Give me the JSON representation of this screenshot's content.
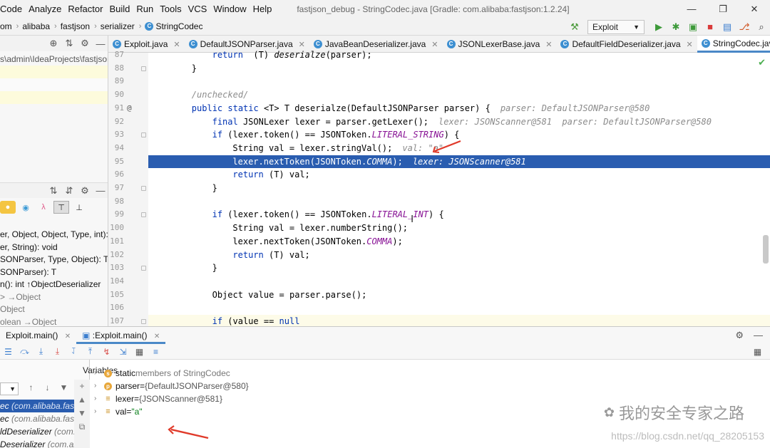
{
  "menu": {
    "items": [
      "Code",
      "Analyze",
      "Refactor",
      "Build",
      "Run",
      "Tools",
      "VCS",
      "Window",
      "Help"
    ],
    "window_title": "fastjson_debug - StringCodec.java [Gradle: com.alibaba:fastjson:1.2.24]",
    "controls": {
      "minimize": "—",
      "restore": "❐",
      "close": "✕"
    }
  },
  "breadcrumb": {
    "items": [
      "om",
      "alibaba",
      "fastjson",
      "serializer",
      "StringCodec"
    ]
  },
  "runbar": {
    "config_label": "Exploit",
    "icons": [
      "hammer-icon",
      "run-icon",
      "debug-icon",
      "coverage-icon",
      "stop-icon",
      "project-structure-icon",
      "git-icon",
      "search-icon"
    ]
  },
  "project_panel": {
    "path_text": "s\\admin\\IdeaProjects\\fastjson"
  },
  "structure_panel": {
    "items": [
      "er, Object, Object, Type, int): v",
      "er, String): void",
      "SONParser, Type, Object): T ↑C",
      "SONParser): T",
      "n(): int ↑ObjectDeserializer",
      "> →Object",
      "Object",
      "olean →Object"
    ]
  },
  "editor": {
    "tabs": [
      {
        "label": "Exploit.java",
        "active": false
      },
      {
        "label": "DefaultJSONParser.java",
        "active": false
      },
      {
        "label": "JavaBeanDeserializer.java",
        "active": false
      },
      {
        "label": "JSONLexerBase.java",
        "active": false
      },
      {
        "label": "DefaultFieldDeserializer.java",
        "active": false
      },
      {
        "label": "StringCodec.java",
        "active": true
      }
    ],
    "lines": [
      {
        "n": "87",
        "indent": 8,
        "parts": [
          [
            "kw",
            "return"
          ],
          [
            "",
            "  (T) "
          ],
          [
            "method",
            "deserialze"
          ],
          [
            "",
            "(parser);"
          ]
        ]
      },
      {
        "n": "88",
        "indent": 4,
        "parts": [
          [
            "",
            "}"
          ]
        ]
      },
      {
        "n": "89",
        "indent": 0,
        "parts": []
      },
      {
        "n": "90",
        "indent": 4,
        "parts": [
          [
            "cmt",
            "/unchecked/"
          ]
        ]
      },
      {
        "n": "91",
        "indent": 4,
        "parts": [
          [
            "kw",
            "public static"
          ],
          [
            "",
            " <T> T deserialze(DefaultJSONParser parser) {"
          ]
        ],
        "inlay": "parser: DefaultJSONParser@580",
        "gutmark": "@"
      },
      {
        "n": "92",
        "indent": 8,
        "parts": [
          [
            "kw",
            "final"
          ],
          [
            "",
            " JSONLexer lexer = parser.getLexer();"
          ]
        ],
        "inlay": "lexer: JSONScanner@581  parser: DefaultJSONParser@580"
      },
      {
        "n": "93",
        "indent": 8,
        "parts": [
          [
            "kw",
            "if"
          ],
          [
            "",
            " (lexer.token() == JSONToken."
          ],
          [
            "fld",
            "LITERAL_STRING"
          ],
          [
            "",
            ") {"
          ]
        ]
      },
      {
        "n": "94",
        "indent": 12,
        "parts": [
          [
            "",
            "String val = lexer.stringVal();"
          ]
        ],
        "inlay": "val: \"a\""
      },
      {
        "n": "95",
        "indent": 12,
        "parts": [
          [
            "",
            "lexer.nextToken(JSONToken."
          ],
          [
            "fld",
            "COMMA"
          ],
          [
            "",
            ");"
          ]
        ],
        "inlay": "lexer: JSONScanner@581",
        "highlight": true
      },
      {
        "n": "96",
        "indent": 12,
        "parts": [
          [
            "kw",
            "return"
          ],
          [
            "",
            " (T) val;"
          ]
        ]
      },
      {
        "n": "97",
        "indent": 8,
        "parts": [
          [
            "",
            "}"
          ]
        ]
      },
      {
        "n": "98",
        "indent": 0,
        "parts": []
      },
      {
        "n": "99",
        "indent": 8,
        "parts": [
          [
            "kw",
            "if"
          ],
          [
            "",
            " (lexer.token() == JSONToken."
          ],
          [
            "fld",
            "LITERAL_INT"
          ],
          [
            "",
            ") {"
          ]
        ]
      },
      {
        "n": "100",
        "indent": 12,
        "parts": [
          [
            "",
            "String val = lexer.numberString();"
          ]
        ]
      },
      {
        "n": "101",
        "indent": 12,
        "parts": [
          [
            "",
            "lexer.nextToken(JSONToken."
          ],
          [
            "fld",
            "COMMA"
          ],
          [
            "",
            ");"
          ]
        ]
      },
      {
        "n": "102",
        "indent": 12,
        "parts": [
          [
            "kw",
            "return"
          ],
          [
            "",
            " (T) val;"
          ]
        ]
      },
      {
        "n": "103",
        "indent": 8,
        "parts": [
          [
            "",
            "}"
          ]
        ]
      },
      {
        "n": "104",
        "indent": 0,
        "parts": []
      },
      {
        "n": "105",
        "indent": 8,
        "parts": [
          [
            "",
            "Object value = parser.parse();"
          ]
        ]
      },
      {
        "n": "106",
        "indent": 0,
        "parts": []
      },
      {
        "n": "107",
        "indent": 8,
        "parts": [
          [
            "kw",
            "if"
          ],
          [
            "",
            " (value == "
          ],
          [
            "kw",
            "null"
          ],
          [
            ") {"
          ]
        ],
        "cursorline": true
      }
    ]
  },
  "debug": {
    "tabs": [
      {
        "label": "Exploit.main()",
        "active": false,
        "close": "✕"
      },
      {
        "label": ":Exploit.main()",
        "active": true,
        "close": "✕"
      }
    ],
    "variables_header": "Variables",
    "frames": [
      {
        "method": "ec",
        "pkg": "(com.alibaba.fastjs",
        "selected": true
      },
      {
        "method": "ec",
        "pkg": "(com.alibaba.fastjs",
        "selected": false
      },
      {
        "method": "ldDeserializer",
        "pkg": "(com.ali",
        "selected": false
      },
      {
        "method": "Deserializer",
        "pkg": "(com.ali",
        "selected": false
      }
    ],
    "variables": [
      {
        "icon": "s",
        "name": "static",
        "value": "members of StringCodec",
        "type": "static"
      },
      {
        "icon": "p",
        "name": "parser",
        "value": "{DefaultJSONParser@580}",
        "type": "param"
      },
      {
        "icon": "≡",
        "name": "lexer",
        "value": "{JSONScanner@581}",
        "type": "local"
      },
      {
        "icon": "≡",
        "name": "val",
        "value": "\"a\"",
        "type": "string"
      }
    ]
  },
  "watermark": {
    "title": "我的安全专家之路",
    "url": "https://blog.csdn.net/qq_28205153"
  },
  "colors": {
    "selection": "#2a5db0",
    "keyword": "#0033b3",
    "static_field": "#871094",
    "inlay_hint": "#8a8a8a",
    "annotation_arrow": "#e03a2a"
  }
}
